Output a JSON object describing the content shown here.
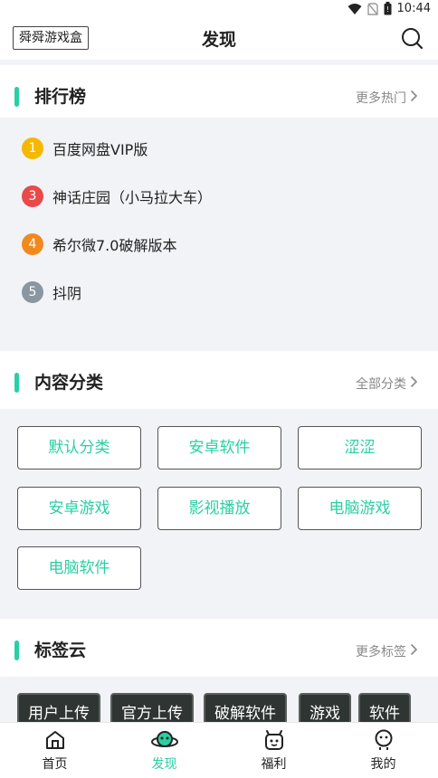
{
  "status_bar": {
    "time": "10:44"
  },
  "header": {
    "brand": "舜舜游戏盒",
    "title": "发现"
  },
  "ranking": {
    "title": "排行榜",
    "more": "更多热门",
    "items": [
      {
        "rank": "1",
        "name": "百度网盘VIP版",
        "color": "#f5b800"
      },
      {
        "rank": "3",
        "name": "神话庄园（小马拉大车）",
        "color": "#e84a4a"
      },
      {
        "rank": "4",
        "name": "希尔微7.0破解版本",
        "color": "#f08a1e"
      },
      {
        "rank": "5",
        "name": "抖阴",
        "color": "#8a96a0"
      }
    ]
  },
  "categories": {
    "title": "内容分类",
    "more": "全部分类",
    "items": [
      "默认分类",
      "安卓软件",
      "涩涩",
      "安卓游戏",
      "影视播放",
      "电脑游戏",
      "电脑软件"
    ]
  },
  "tags": {
    "title": "标签云",
    "more": "更多标签",
    "items": [
      "用户上传",
      "官方上传",
      "破解软件",
      "游戏",
      "软件"
    ]
  },
  "nav": {
    "items": [
      {
        "label": "首页",
        "icon": "home-icon"
      },
      {
        "label": "发现",
        "icon": "planet-icon",
        "active": true
      },
      {
        "label": "福利",
        "icon": "gift-face-icon"
      },
      {
        "label": "我的",
        "icon": "profile-icon"
      }
    ]
  },
  "colors": {
    "accent": "#2bcfa4",
    "panel_bg": "#f2f3f7",
    "tag_bg": "#2f3533"
  }
}
